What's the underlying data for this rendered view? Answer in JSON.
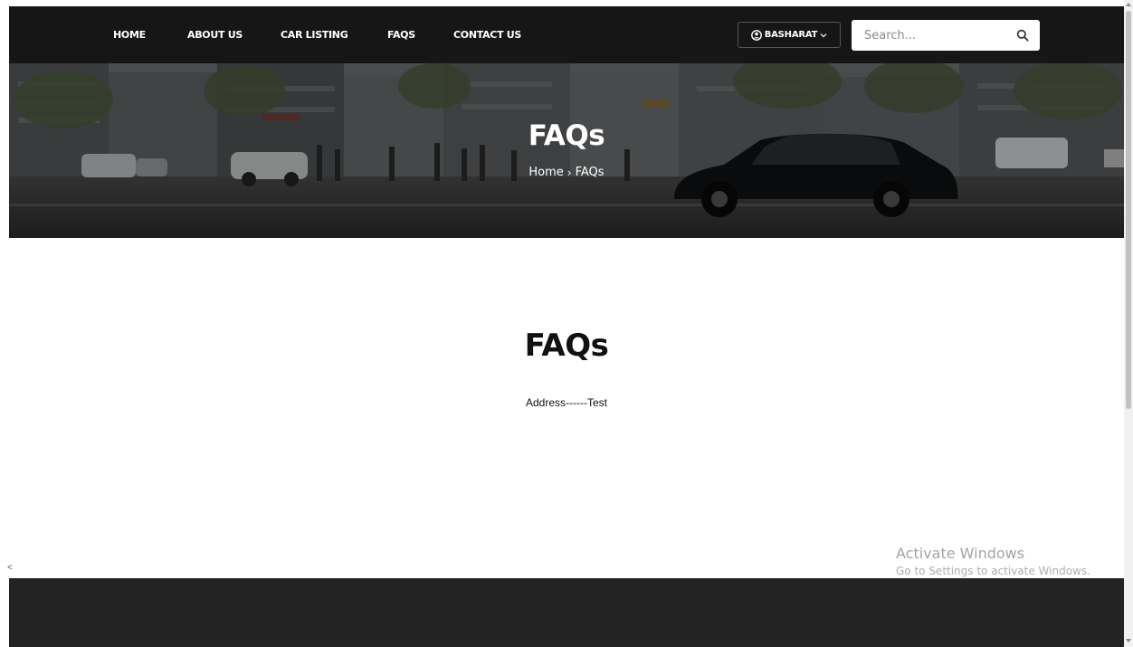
{
  "nav": {
    "items": [
      {
        "label": "HOME"
      },
      {
        "label": "ABOUT US"
      },
      {
        "label": "CAR LISTING"
      },
      {
        "label": "FAQS"
      },
      {
        "label": "CONTACT US"
      }
    ],
    "user_label": "BASHARAT",
    "user_icon": "user-circle-icon",
    "caret_icon": "chevron-down-icon",
    "search": {
      "placeholder": "Search...",
      "value": "",
      "icon": "search-icon"
    }
  },
  "hero": {
    "title": "FAQs",
    "breadcrumb": {
      "home": "Home",
      "separator": "›",
      "current": "FAQs"
    }
  },
  "content": {
    "title": "FAQs",
    "body": "Address------Test"
  },
  "scroll_left_glyph": "<",
  "watermark": {
    "title": "Activate Windows",
    "subtitle": "Go to Settings to activate Windows."
  },
  "colors": {
    "navbar_bg": "#161616",
    "footer_bg": "#232323",
    "text_dark": "#111111"
  }
}
